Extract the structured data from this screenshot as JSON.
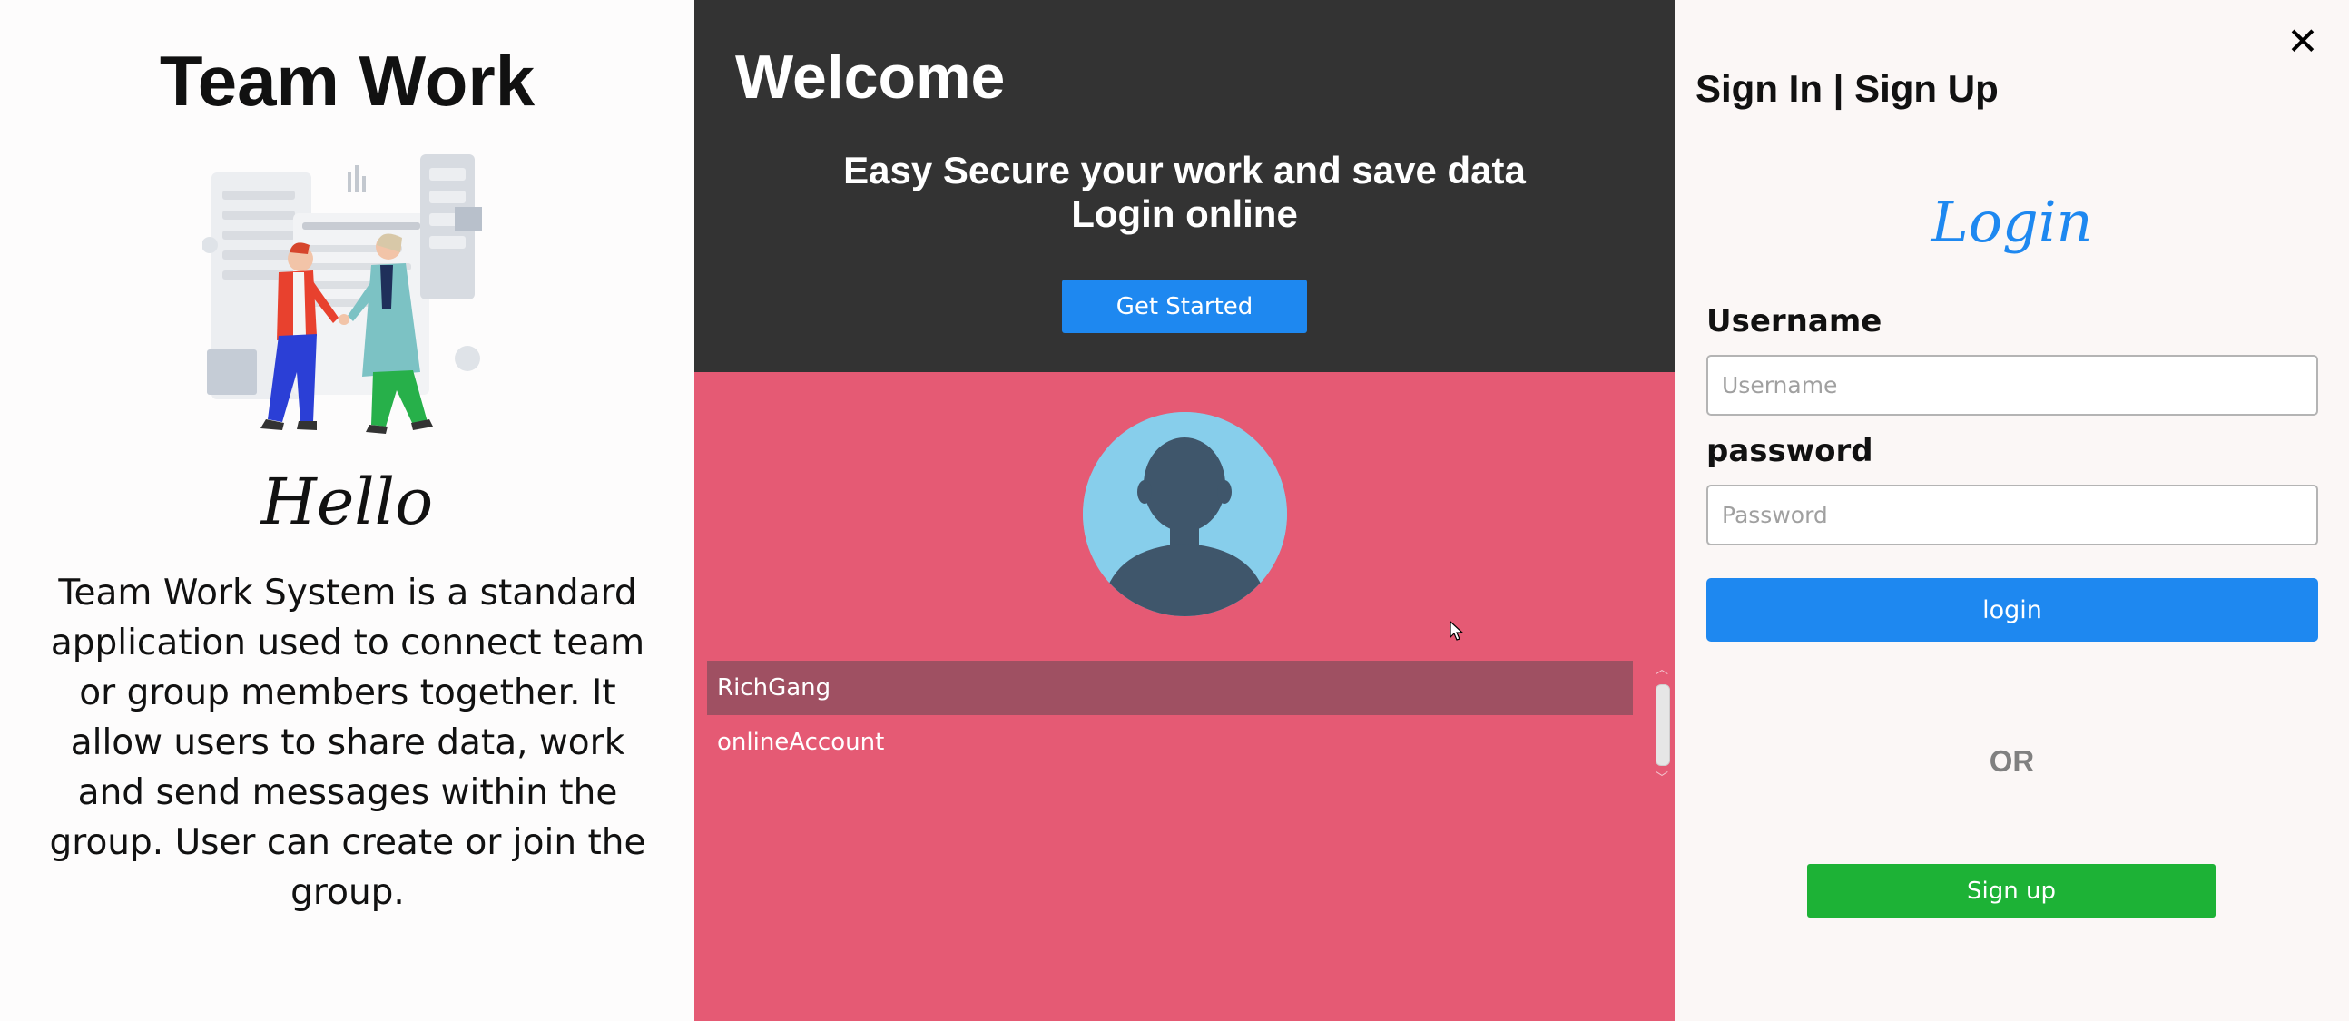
{
  "left_panel": {
    "app_title": "Team Work",
    "illustration_icon": "team-collaboration-illustration",
    "greeting": "Hello",
    "description": "Team Work System is a standard application used to connect team or group members together. It allow users to share data, work and send messages within the group. User can create or join the group."
  },
  "welcome_panel": {
    "title": "Welcome",
    "tagline_line1": "Easy Secure your work and save data",
    "tagline_line2": "Login online",
    "get_started_label": "Get Started"
  },
  "accounts_panel": {
    "avatar_icon": "user-avatar-icon",
    "accounts": [
      {
        "label": "RichGang",
        "selected": true
      },
      {
        "label": "onlineAccount",
        "selected": false
      }
    ]
  },
  "auth_panel": {
    "close_icon": "close-icon",
    "heading": "Sign In | Sign Up",
    "login_title": "Login",
    "username_label": "Username",
    "username_placeholder": "Username",
    "username_value": "",
    "password_label": "password",
    "password_placeholder": "Password",
    "password_value": "",
    "login_button": "login",
    "or_text": "OR",
    "signup_button": "Sign up"
  },
  "colors": {
    "dark_header": "#333333",
    "accounts_bg": "#e55a74",
    "selected_row": "#9f5062",
    "primary_blue": "#1e88f0",
    "signup_green": "#1db236",
    "avatar_bg": "#87ceeb",
    "avatar_fg": "#3f566b"
  }
}
